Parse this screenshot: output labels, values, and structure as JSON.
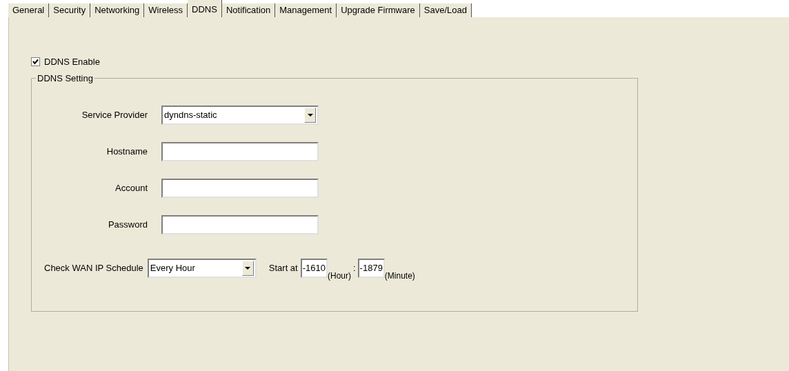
{
  "tabs": [
    {
      "label": "General",
      "selected": false
    },
    {
      "label": "Security",
      "selected": false
    },
    {
      "label": "Networking",
      "selected": false
    },
    {
      "label": "Wireless",
      "selected": false
    },
    {
      "label": "DDNS",
      "selected": true
    },
    {
      "label": "Notification",
      "selected": false
    },
    {
      "label": "Management",
      "selected": false
    },
    {
      "label": "Upgrade Firmware",
      "selected": false
    },
    {
      "label": "Save/Load",
      "selected": false
    }
  ],
  "enable": {
    "label": "DDNS Enable",
    "checked": true
  },
  "group": {
    "title": "DDNS Setting",
    "fields": [
      {
        "kind": "select",
        "label": "Service Provider",
        "value": "dyndns-static"
      },
      {
        "kind": "text",
        "label": "Hostname"
      },
      {
        "kind": "text",
        "label": "Account"
      },
      {
        "kind": "text",
        "label": "Password"
      }
    ],
    "schedule": {
      "label": "Check WAN IP Schedule",
      "value": "Every Hour",
      "start_label": "Start at",
      "hour": "-1610",
      "hour_unit": "(Hour)",
      "separator": ":",
      "minute": "-1879",
      "minute_unit": "(Minute)"
    }
  }
}
